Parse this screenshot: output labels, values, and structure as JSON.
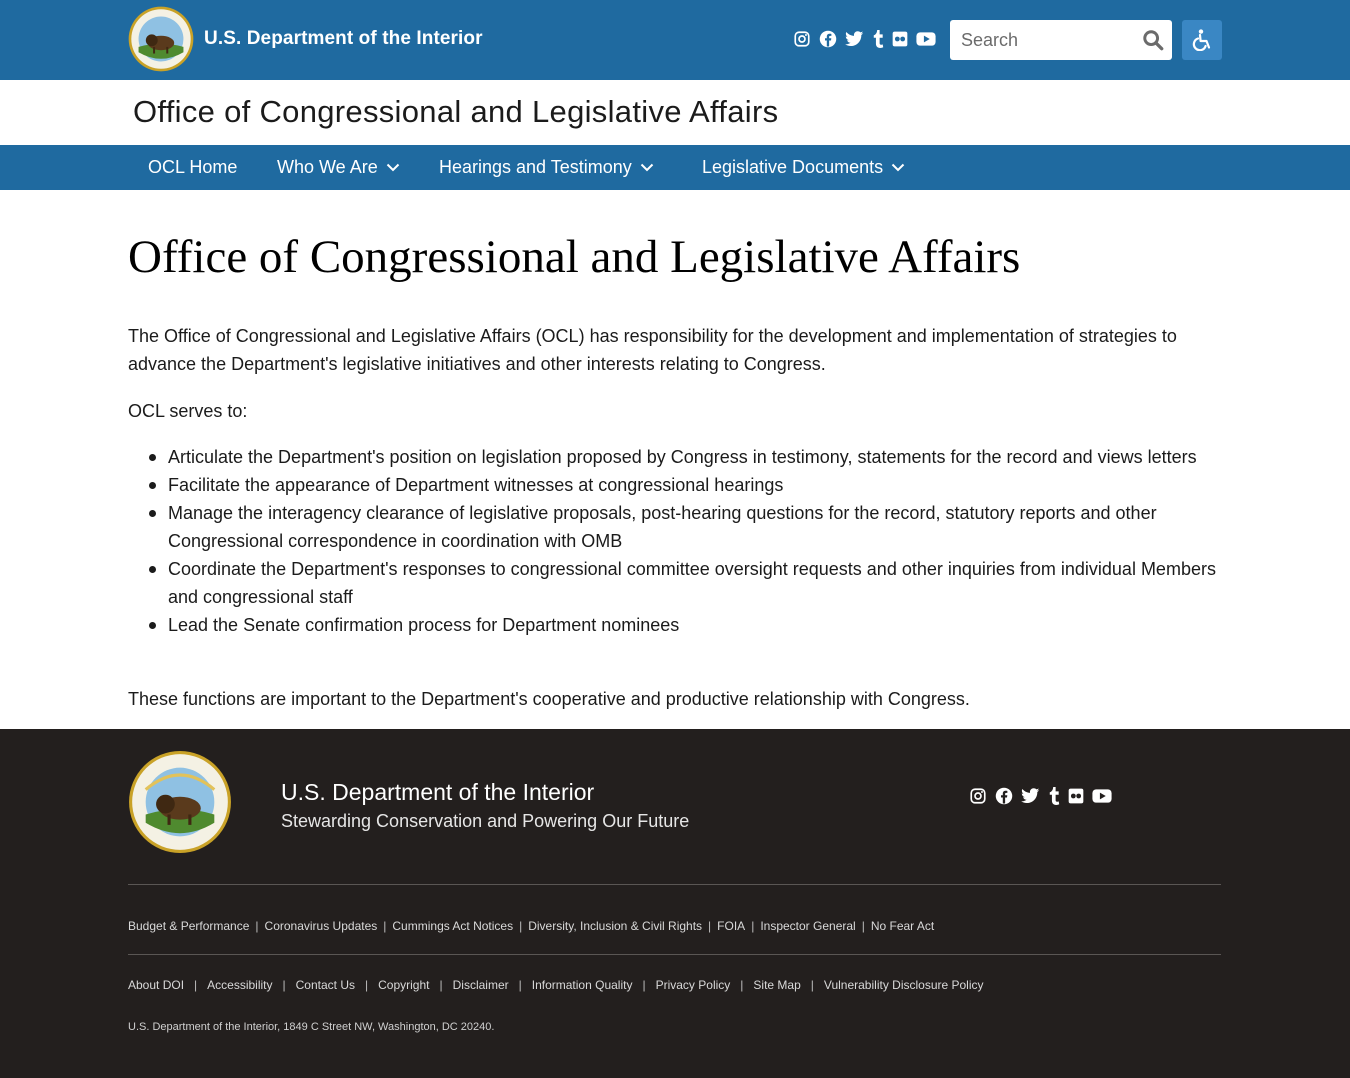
{
  "header": {
    "site_title": "U.S. Department of the Interior",
    "social_icons": [
      "instagram-icon",
      "facebook-icon",
      "twitter-icon",
      "tumblr-icon",
      "flickr-icon",
      "youtube-icon"
    ],
    "search": {
      "placeholder": "Search",
      "value": ""
    },
    "accessibility_icon": "wheelchair-icon"
  },
  "office": {
    "title": "Office of Congressional and Legislative Affairs"
  },
  "nav": {
    "items": [
      {
        "label": "OCL Home",
        "has_dropdown": false
      },
      {
        "label": "Who We Are",
        "has_dropdown": true
      },
      {
        "label": "Hearings and Testimony",
        "has_dropdown": true
      },
      {
        "label": "Legislative Documents",
        "has_dropdown": true
      }
    ]
  },
  "main": {
    "title": "Office of Congressional and Legislative Affairs",
    "intro": "The Office of Congressional and Legislative Affairs (OCL) has responsibility for the development and implementation of strategies to advance the Department's legislative initiatives and other interests relating to Congress.",
    "serves_label": "OCL serves to:",
    "bullets": [
      "Articulate the Department's position on legislation proposed by Congress in testimony, statements for the record and views letters",
      "Facilitate the appearance of Department witnesses at congressional hearings",
      "Manage the interagency clearance of legislative proposals, post-hearing questions for the record, statutory reports and other Congressional correspondence in coordination with OMB",
      "Coordinate the Department's responses to congressional committee oversight requests and other inquiries from individual Members and congressional staff",
      "Lead the Senate confirmation process for Department nominees"
    ],
    "closing": "These functions are important to the Department's cooperative and productive relationship with Congress."
  },
  "footer": {
    "title": "U.S. Department of the Interior",
    "tagline": "Stewarding Conservation and Powering Our Future",
    "links_row1": [
      "Budget & Performance",
      "Coronavirus Updates",
      "Cummings Act Notices",
      "Diversity, Inclusion & Civil Rights",
      "FOIA",
      "Inspector General",
      "No Fear Act"
    ],
    "links_row2": [
      "About DOI",
      "Accessibility",
      "Contact Us",
      "Copyright",
      "Disclaimer",
      "Information Quality",
      "Privacy Policy",
      "Site Map",
      "Vulnerability Disclosure Policy"
    ],
    "address": "U.S. Department of the Interior, 1849 C Street NW, Washington, DC 20240."
  },
  "colors": {
    "header_blue": "#1f6aa0",
    "accessibility_button": "#3a87c4",
    "footer_bg": "#231f1e"
  }
}
